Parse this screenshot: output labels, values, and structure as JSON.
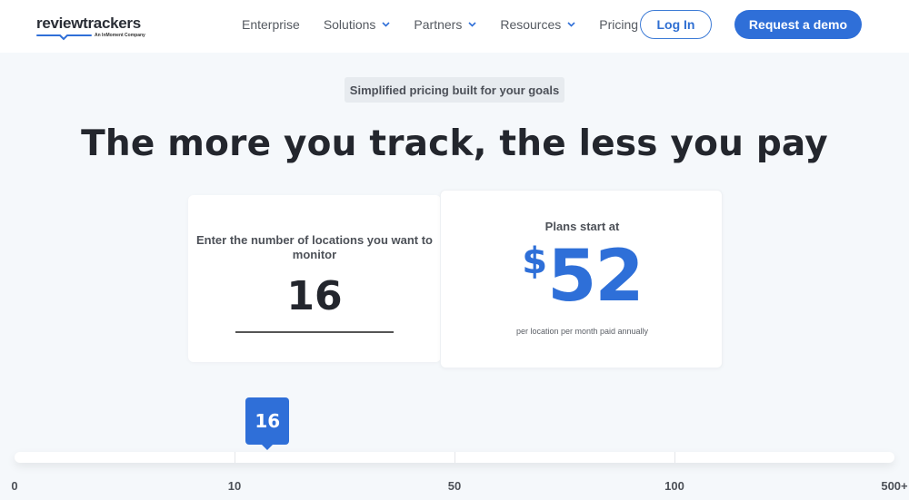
{
  "header": {
    "logo": {
      "name": "reviewtrackers",
      "tagline": "An InMoment Company",
      "swoosh_color": "#2f6fd8"
    },
    "nav": [
      {
        "label": "Enterprise",
        "has_dropdown": false
      },
      {
        "label": "Solutions",
        "has_dropdown": true
      },
      {
        "label": "Partners",
        "has_dropdown": true
      },
      {
        "label": "Resources",
        "has_dropdown": true
      },
      {
        "label": "Pricing",
        "has_dropdown": false
      }
    ],
    "login_label": "Log In",
    "demo_label": "Request a demo"
  },
  "hero": {
    "pill": "Simplified pricing built for your goals",
    "headline": "The more you track, the less you pay"
  },
  "calculator": {
    "input_label": "Enter the number of locations you want to monitor",
    "locations_value": "16",
    "plans_label": "Plans start at",
    "currency_symbol": "$",
    "price": "52",
    "price_note": "per location per month paid annually"
  },
  "slider": {
    "value": 16,
    "value_label": "16",
    "ticks": [
      "0",
      "10",
      "50",
      "100",
      "500+"
    ]
  },
  "colors": {
    "accent": "#2f6fd8",
    "text_dark": "#23262d",
    "background": "#f5f8fb"
  }
}
